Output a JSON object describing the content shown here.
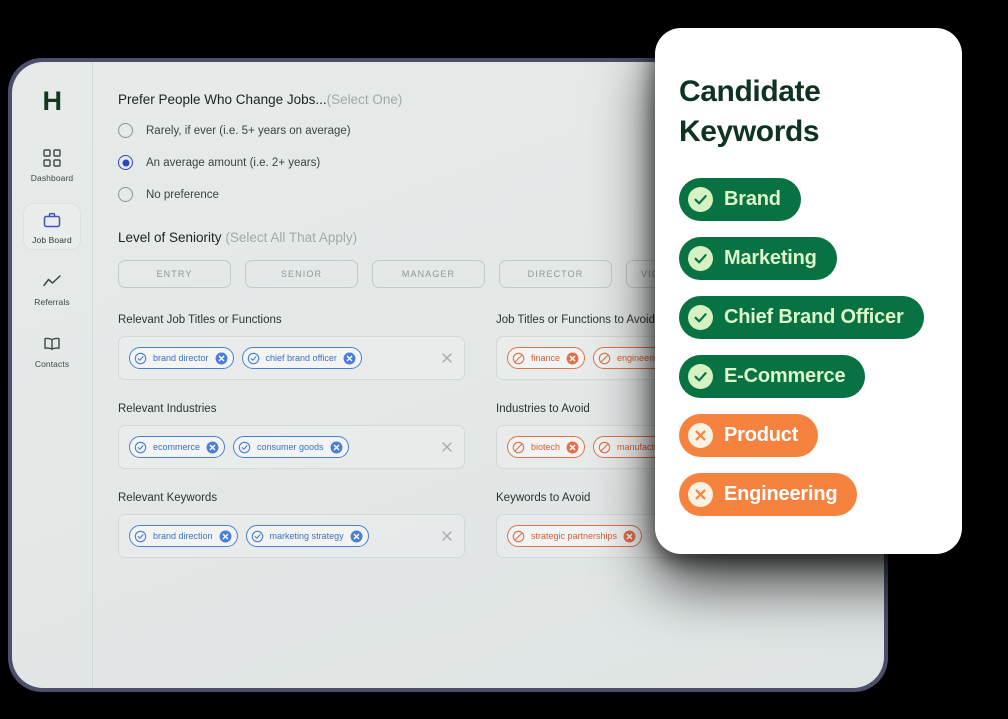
{
  "sidebar": {
    "logo": "H",
    "items": [
      {
        "label": "Dashboard",
        "icon": "grid-icon",
        "active": false
      },
      {
        "label": "Job Board",
        "icon": "briefcase-icon",
        "active": true
      },
      {
        "label": "Referrals",
        "icon": "trend-line-icon",
        "active": false
      },
      {
        "label": "Contacts",
        "icon": "book-icon",
        "active": false
      }
    ]
  },
  "form": {
    "change_jobs": {
      "title": "Prefer People Who Change Jobs...",
      "hint": "(Select One)",
      "options": [
        {
          "label": "Rarely, if ever (i.e. 5+ years on average)",
          "selected": false
        },
        {
          "label": "An average amount (i.e. 2+ years)",
          "selected": true
        },
        {
          "label": "No preference",
          "selected": false
        }
      ]
    },
    "seniority": {
      "title": "Level of Seniority",
      "hint": "(Select All That Apply)",
      "levels": [
        "ENTRY",
        "SENIOR",
        "MANAGER",
        "DIRECTOR",
        "VICE PRESIDENT"
      ]
    },
    "chip_blocks": [
      {
        "label": "Relevant Job Titles or Functions",
        "tone": "blue",
        "chips": [
          "brand director",
          "chief brand officer"
        ]
      },
      {
        "label": "Job Titles or Functions to Avoid",
        "tone": "orange",
        "chips": [
          "finance",
          "engineering"
        ]
      },
      {
        "label": "Relevant Industries",
        "tone": "blue",
        "chips": [
          "ecommerce",
          "consumer goods"
        ]
      },
      {
        "label": "Industries to Avoid",
        "tone": "orange",
        "chips": [
          "biotech",
          "manufacturing"
        ]
      },
      {
        "label": "Relevant Keywords",
        "tone": "blue",
        "chips": [
          "brand direction",
          "marketing strategy"
        ]
      },
      {
        "label": "Keywords to Avoid",
        "tone": "orange",
        "chips": [
          "strategic partnerships"
        ]
      }
    ]
  },
  "card": {
    "title": "Candidate Keywords",
    "keywords": [
      {
        "label": "Brand",
        "tone": "good"
      },
      {
        "label": "Marketing",
        "tone": "good"
      },
      {
        "label": "Chief Brand Officer",
        "tone": "good"
      },
      {
        "label": "E-Commerce",
        "tone": "good"
      },
      {
        "label": "Product",
        "tone": "bad"
      },
      {
        "label": "Engineering",
        "tone": "bad"
      }
    ]
  },
  "colors": {
    "green_pill": "#087243",
    "green_text": "#ddf5c8",
    "orange_pill": "#f5833f",
    "card_title": "#0f3321",
    "blue_chip": "#3f6fc4",
    "orange_chip": "#d65f35",
    "radio_selected": "#2f45c5",
    "tablet_bezel": "#4b4f6b"
  }
}
